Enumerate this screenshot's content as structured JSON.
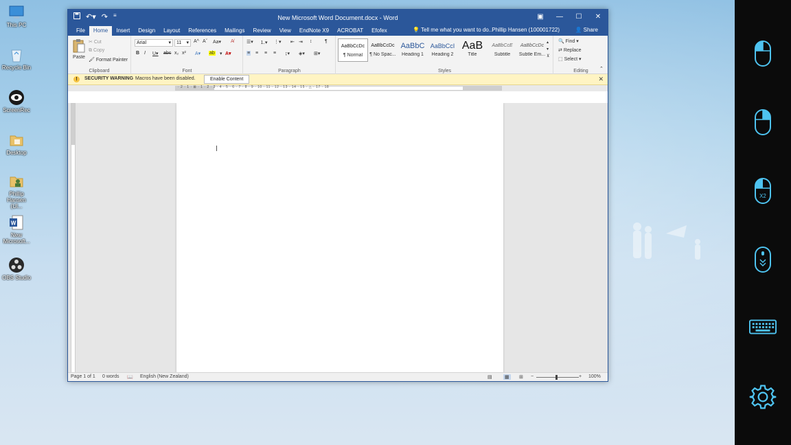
{
  "desktop": {
    "icons": [
      {
        "label": "This PC",
        "color": "#3b8fd8"
      },
      {
        "label": "Recycle Bin",
        "color": "#cfe3f2"
      },
      {
        "label": "ScreenRec",
        "color": "#222222"
      },
      {
        "label": "Desktop",
        "color": "#e9c26a"
      },
      {
        "label": "Phillip Hansen (Ul...",
        "color": "#e9c26a"
      },
      {
        "label": "New Microsoft...",
        "color": "#2b579a"
      },
      {
        "label": "OBS Studio",
        "color": "#2a2a2a"
      }
    ]
  },
  "window": {
    "title": "New Microsoft Word Document.docx - Word",
    "qat": {
      "save_icon": "save-icon",
      "undo_icon": "undo-icon",
      "redo_icon": "redo-icon"
    },
    "tabs": [
      "File",
      "Home",
      "Insert",
      "Design",
      "Layout",
      "References",
      "Mailings",
      "Review",
      "View",
      "EndNote X9",
      "ACROBAT",
      "Efofex"
    ],
    "active_tab": "Home",
    "tell_me": "Tell me what you want to do...",
    "user": "Phillip Hansen (100001722)",
    "share": "Share"
  },
  "ribbon": {
    "clipboard": {
      "paste": "Paste",
      "cut": "Cut",
      "copy": "Copy",
      "format_painter": "Format Painter",
      "label": "Clipboard"
    },
    "font": {
      "name": "Arial",
      "size": "11",
      "label": "Font"
    },
    "paragraph": {
      "label": "Paragraph"
    },
    "styles": {
      "label": "Styles",
      "items": [
        {
          "preview": "AaBbCcDc",
          "name": "¶ Normal"
        },
        {
          "preview": "AaBbCcDc",
          "name": "¶ No Spac..."
        },
        {
          "preview": "AaBbC",
          "name": "Heading 1"
        },
        {
          "preview": "AaBbCcI",
          "name": "Heading 2"
        },
        {
          "preview": "AaB",
          "name": "Title"
        },
        {
          "preview": "AaBbCcE",
          "name": "Subtitle"
        },
        {
          "preview": "AaBbCcDc",
          "name": "Subtle Em..."
        }
      ]
    },
    "editing": {
      "find": "Find",
      "replace": "Replace",
      "select": "Select",
      "label": "Editing"
    }
  },
  "security": {
    "title": "SECURITY WARNING",
    "message": "Macros have been disabled.",
    "button": "Enable Content"
  },
  "ruler": {
    "numbers": "· 2 · 1 · ⊠ · 1 · 2 · 3 · 4 · 5 · 6 · 7 · 8 · 9 · 10 · 11 · 12 · 13 · 14 · 15 · △ · 17 · 18"
  },
  "status": {
    "page": "Page 1 of 1",
    "words": "0 words",
    "language": "English (New Zealand)",
    "zoom": "100%"
  },
  "colors": {
    "word_blue": "#2b579a",
    "panel_accent": "#4ec3f0"
  },
  "sidepanel": {
    "icons": [
      "mouse-left-click-icon",
      "mouse-right-click-icon",
      "mouse-double-click-icon",
      "mouse-scroll-icon",
      "keyboard-icon",
      "settings-icon"
    ],
    "double_click_label": "X2"
  }
}
